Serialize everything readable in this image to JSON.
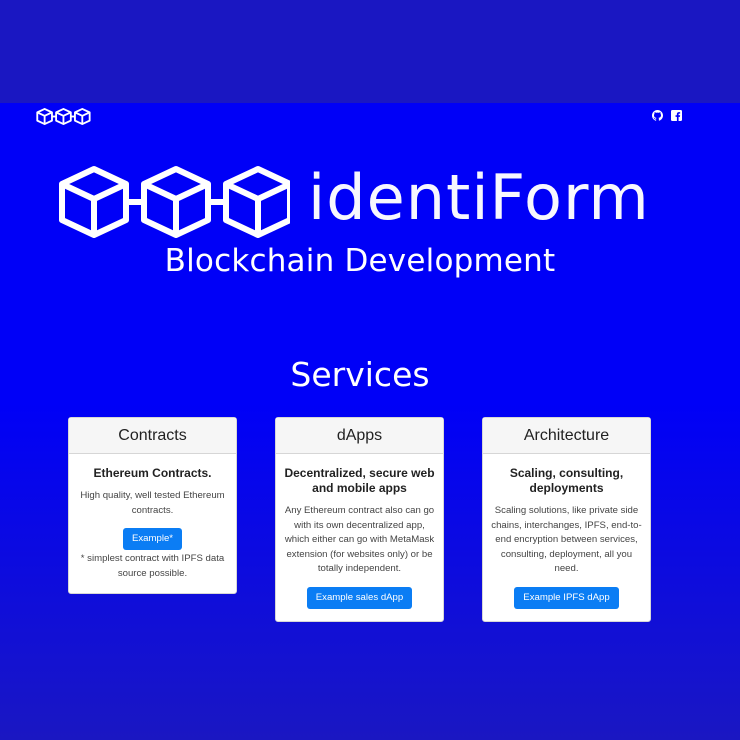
{
  "brand": {
    "name": "identiForm",
    "tagline": "Blockchain Development",
    "logo_icon": "three-linked-cubes-icon",
    "color_primary": "#0000f7",
    "color_button": "#0b7df4"
  },
  "navbar": {
    "icons": [
      "github-icon",
      "facebook-icon"
    ]
  },
  "services": {
    "title": "Services",
    "cards": [
      {
        "header": "Contracts",
        "title": "Ethereum Contracts.",
        "text": "High quality, well tested Ethereum contracts.",
        "button": "Example*",
        "note": "* simplest contract with IPFS data source possible."
      },
      {
        "header": "dApps",
        "title": "Decentralized, secure web and mobile apps",
        "text": "Any Ethereum contract also can go with its own decentralized app, which either can go with MetaMask extension (for websites only) or be totally independent.",
        "button": "Example sales dApp"
      },
      {
        "header": "Architecture",
        "title": "Scaling, consulting, deployments",
        "text": "Scaling solutions, like private side chains, interchanges, IPFS, end-to-end encryption between services, consulting, deployment, all you need.",
        "button": "Example IPFS dApp"
      }
    ]
  }
}
